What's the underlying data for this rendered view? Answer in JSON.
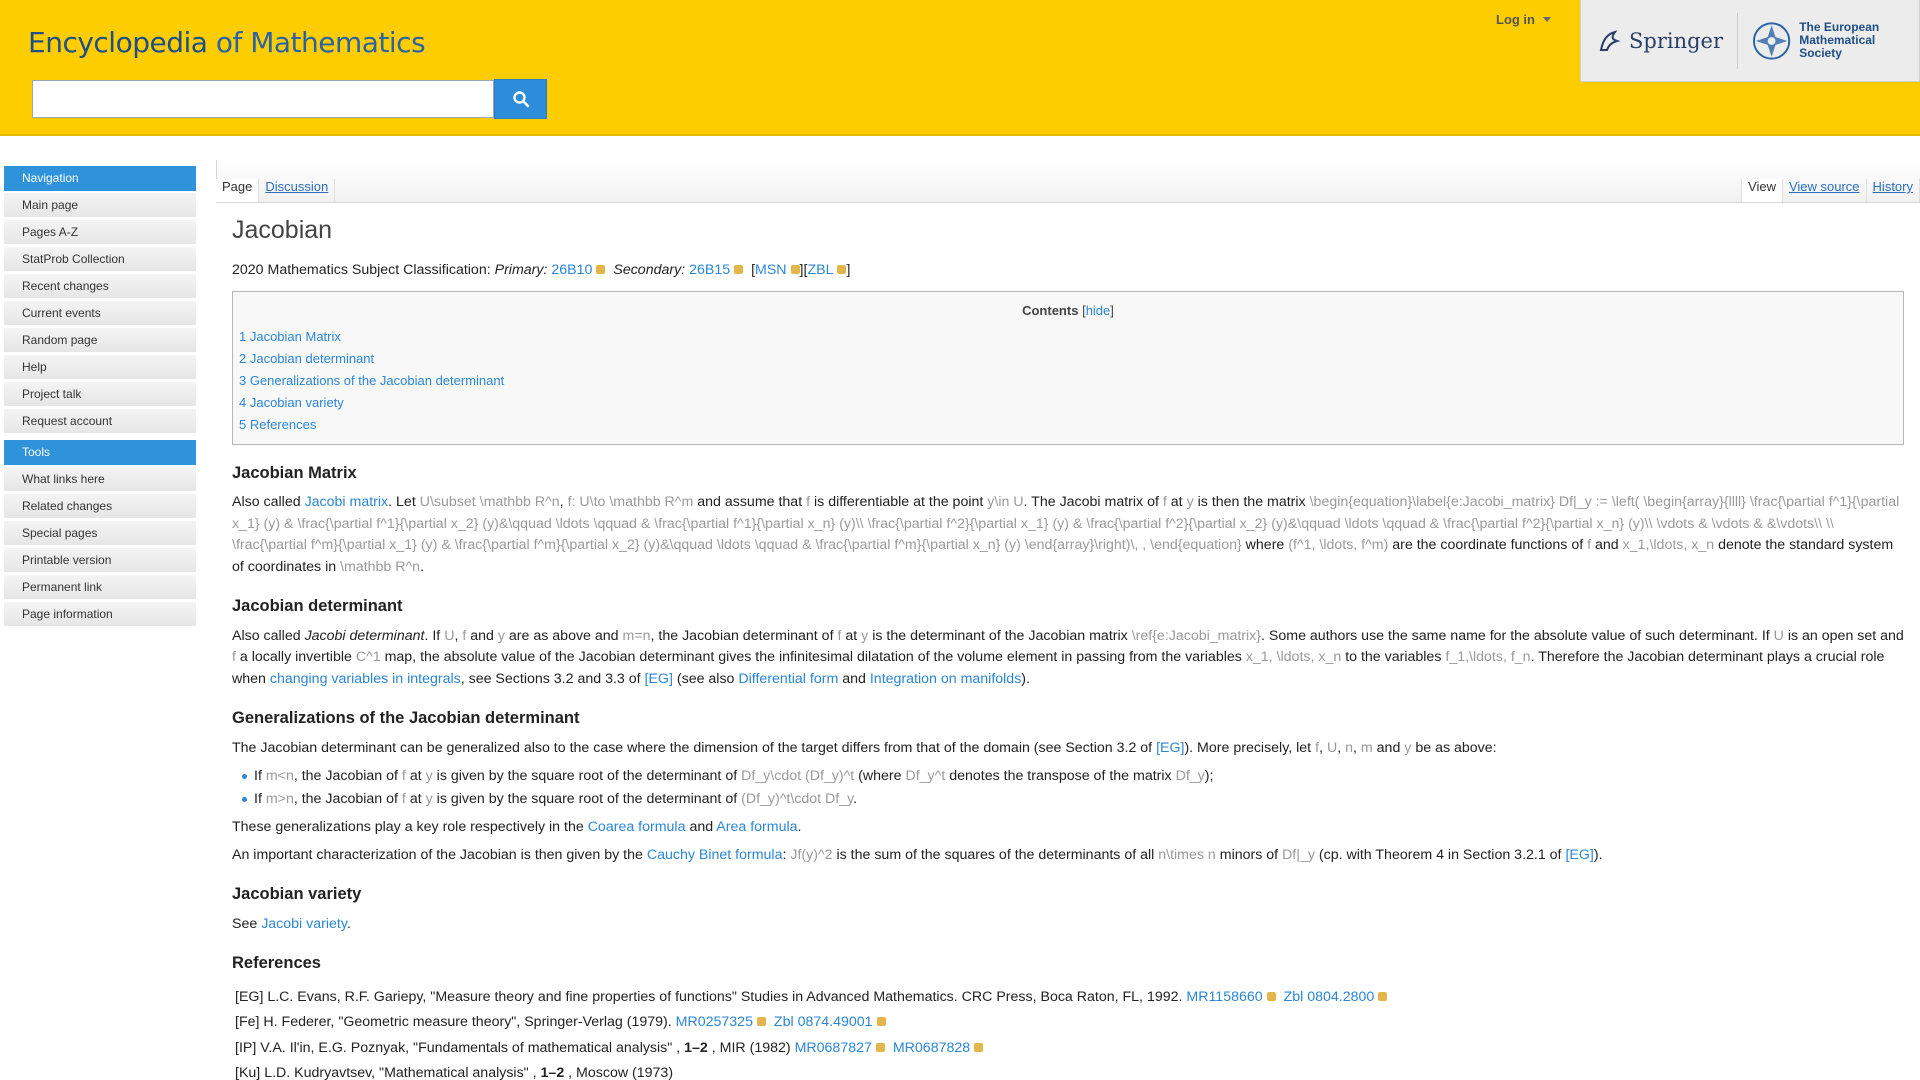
{
  "header": {
    "logo_main": "Encyclopedia",
    "logo_rest": "of Mathematics",
    "login": "Log in",
    "springer": "Springer",
    "ems_line1": "The European",
    "ems_line2": "Mathematical Society"
  },
  "sidebar": {
    "nav_title": "Navigation",
    "nav_items": [
      "Main page",
      "Pages A-Z",
      "StatProb Collection",
      "Recent changes",
      "Current events",
      "Random page",
      "Help",
      "Project talk",
      "Request account"
    ],
    "tools_title": "Tools",
    "tools_items": [
      "What links here",
      "Related changes",
      "Special pages",
      "Printable version",
      "Permanent link",
      "Page information"
    ]
  },
  "tabs": {
    "page": "Page",
    "discussion": "Discussion",
    "view": "View",
    "view_source": "View source",
    "history": "History"
  },
  "article": {
    "title": "Jacobian",
    "msc_prefix": "2020 Mathematics Subject Classification:",
    "primary_label": "Primary:",
    "primary_code": "26B10",
    "secondary_label": "Secondary:",
    "secondary_code": "26B15",
    "msn": "MSN",
    "zbl": "ZBL",
    "toc_title": "Contents",
    "toc_hide": "hide",
    "toc": [
      "1 Jacobian Matrix",
      "2 Jacobian determinant",
      "3 Generalizations of the Jacobian determinant",
      "4 Jacobian variety",
      "5 References"
    ],
    "s1_title": "Jacobian Matrix",
    "s1_text": {
      "a": "Also called",
      "link": "Jacobi matrix",
      "b": ". Let",
      "m1": "U\\subset \\mathbb R^n",
      "c": ",",
      "m2": "f: U\\to \\mathbb R^m",
      "d": "and assume that",
      "m3": "f",
      "e": "is differentiable at the point",
      "m4": "y\\in U",
      "f": ". The Jacobi matrix of",
      "m5": "f",
      "g": "at",
      "m6": "y",
      "h": "is then the matrix",
      "m7": "\\begin{equation}\\label{e:Jacobi_matrix} Df|_y := \\left( \\begin{array}{llll} \\frac{\\partial f^1}{\\partial x_1} (y) & \\frac{\\partial f^1}{\\partial x_2} (y)&\\qquad \\ldots \\qquad & \\frac{\\partial f^1}{\\partial x_n} (y)\\\\ \\frac{\\partial f^2}{\\partial x_1} (y) & \\frac{\\partial f^2}{\\partial x_2} (y)&\\qquad \\ldots \\qquad & \\frac{\\partial f^2}{\\partial x_n} (y)\\\\ \\vdots & \\vdots & &\\vdots\\\\ \\\\ \\frac{\\partial f^m}{\\partial x_1} (y) & \\frac{\\partial f^m}{\\partial x_2} (y)&\\qquad \\ldots \\qquad & \\frac{\\partial f^m}{\\partial x_n} (y) \\end{array}\\right)\\, , \\end{equation}",
      "i": "where",
      "m8": "(f^1, \\ldots, f^m)",
      "j": "are the coordinate functions of",
      "m9": "f",
      "k": "and",
      "m10": "x_1,\\ldots, x_n",
      "l": "denote the standard system of coordinates in",
      "m11": "\\mathbb R^n",
      "end": "."
    },
    "s2_title": "Jacobian determinant",
    "s2_text": {
      "a": "Also called",
      "em": "Jacobi determinant",
      "b": ". If",
      "m1": "U",
      "c": ",",
      "m2": "f",
      "d": "and",
      "m3": "y",
      "e": "are as above and",
      "m4": "m=n",
      "f": ", the Jacobian determinant of",
      "m5": "f",
      "g": "at",
      "m6": "y",
      "h": "is the determinant of the Jacobian matrix",
      "m7": "\\ref{e:Jacobi_matrix}",
      "i": ". Some authors use the same name for the absolute value of such determinant. If",
      "m8": "U",
      "j": "is an open set and",
      "m9": "f",
      "k": "a locally invertible",
      "m10": "C^1",
      "l": "map, the absolute value of the Jacobian determinant gives the infinitesimal dilatation of the volume element in passing from the variables",
      "m11": "x_1, \\ldots, x_n",
      "n": "to the variables",
      "m12": "f_1,\\ldots, f_n",
      "o": ". Therefore the Jacobian determinant plays a crucial role when",
      "link1": "changing variables in integrals",
      "p": ", see Sections 3.2 and 3.3 of",
      "link2": "[EG]",
      "q": "(see also",
      "link3": "Differential form",
      "r": "and",
      "link4": "Integration on manifolds",
      "end": ")."
    },
    "s3_title": "Generalizations of the Jacobian determinant",
    "s3_text": {
      "a": "The Jacobian determinant can be generalized also to the case where the dimension of the target differs from that of the domain (see Section 3.2 of",
      "link1": "[EG]",
      "b": "). More precisely, let",
      "m1": "f",
      "c1": ",",
      "m2": "U",
      "c2": ",",
      "m3": "n",
      "c3": ",",
      "m4": "m",
      "d": "and",
      "m5": "y",
      "e": "be as above:"
    },
    "s3_bullets": [
      {
        "a": "If",
        "m1": "m<n",
        "b": ", the Jacobian of",
        "m2": "f",
        "c": "at",
        "m3": "y",
        "d": "is given by the square root of the determinant of",
        "m4": "Df_y\\cdot (Df_y)^t",
        "e": "(where",
        "m5": "Df_y^t",
        "f": "denotes the transpose of the matrix",
        "m6": "Df_y",
        "g": ");"
      },
      {
        "a": "If",
        "m1": "m>n",
        "b": ", the Jacobian of",
        "m2": "f",
        "c": "at",
        "m3": "y",
        "d": "is given by the square root of the determinant of",
        "m4": "(Df_y)^t\\cdot Df_y",
        "e": ".",
        "m5": "",
        "f": "",
        "m6": "",
        "g": ""
      }
    ],
    "s3_p2": {
      "a": "These generalizations play a key role respectively in the",
      "link1": "Coarea formula",
      "b": "and",
      "link2": "Area formula",
      "end": "."
    },
    "s3_p3": {
      "a": "An important characterization of the Jacobian is then given by the",
      "link1": "Cauchy Binet formula",
      "b": ":",
      "m1": "Jf(y)^2",
      "c": "is the sum of the squares of the determinants of all",
      "m2": "n\\times n",
      "d": "minors of",
      "m3": "Df|_y",
      "e": "(cp. with Theorem 4 in Section 3.2.1 of",
      "link2": "[EG]",
      "end": ")."
    },
    "s4_title": "Jacobian variety",
    "s4_text": {
      "a": "See",
      "link": "Jacobi variety",
      "end": "."
    },
    "s5_title": "References",
    "refs": [
      {
        "tag": "[EG]",
        "text": "L.C. Evans, R.F. Gariepy, \"Measure theory and fine properties of functions\" Studies in Advanced Mathematics. CRC Press, Boca Raton, FL, 1992.",
        "bold": "",
        "after": "",
        "link1": "MR1158660",
        "link2": "Zbl 0804.2800"
      },
      {
        "tag": "[Fe]",
        "text": "H. Federer, \"Geometric measure theory\", Springer-Verlag (1979).",
        "bold": "",
        "after": "",
        "link1": "MR0257325",
        "link2": "Zbl 0874.49001"
      },
      {
        "tag": "[IP]",
        "text": "V.A. Il'in, E.G. Poznyak, \"Fundamentals of mathematical analysis\" ,",
        "bold": "1–2",
        "after": ", MIR (1982)",
        "link1": "MR0687827",
        "link2": "MR0687828"
      },
      {
        "tag": "[Ku]",
        "text": "L.D. Kudryavtsev, \"Mathematical analysis\" ,",
        "bold": "1–2",
        "after": ", Moscow (1973)",
        "link1": "",
        "link2": ""
      }
    ]
  },
  "colors": {
    "header_bg": "#fecd00",
    "sidebar_head": "#2f93dc",
    "link": "#2b86d6",
    "math": "#9a9a9a"
  }
}
